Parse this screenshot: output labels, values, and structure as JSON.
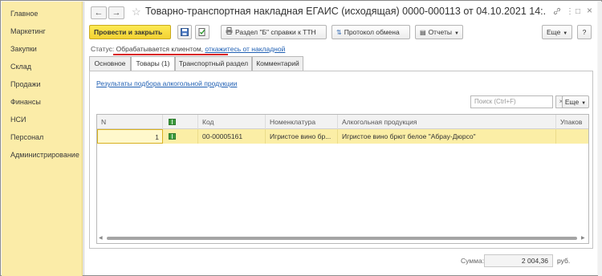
{
  "sidebar": {
    "items": [
      "Главное",
      "Маркетинг",
      "Закупки",
      "Склад",
      "Продажи",
      "Финансы",
      "НСИ",
      "Персонал",
      "Администрирование"
    ]
  },
  "window": {
    "title": "Товарно-транспортная накладная ЕГАИС (исходящая) 0000-000113 от 04.10.2021 14:...",
    "back_icon": "←",
    "forward_icon": "→",
    "star_icon": "☆",
    "link_icon": "🔗",
    "menu_icon": "⋮",
    "max_icon": "□",
    "close_icon": "×"
  },
  "toolbar": {
    "post_close": "Провести и закрыть",
    "section_b": "Раздел \"Б\" справки к ТТН",
    "exchange_protocol": "Протокол обмена",
    "reports": "Отчеты",
    "more": "Еще",
    "help": "?"
  },
  "status": {
    "label": "Статус:",
    "value": "Обрабатывается клиентом,",
    "reject_link": "откажитесь от накладной"
  },
  "tabs": [
    "Основное",
    "Товары (1)",
    "Транспортный раздел",
    "Комментарий"
  ],
  "goods": {
    "results_link": "Результаты подбора алкогольной продукции",
    "search_placeholder": "Поиск (Ctrl+F)",
    "search_clear": "×",
    "more": "Еще",
    "columns": [
      "N",
      "",
      "Код",
      "Номенклатура",
      "Алкогольная продукция",
      "Упаков"
    ],
    "rows": [
      {
        "n": "1",
        "code": "00-00005161",
        "nomenclature": "Игристое вино бр...",
        "product": "Игристое вино брют белое \"Абрау-Дюрсо\""
      }
    ]
  },
  "footer": {
    "sum_label": "Сумма:",
    "sum_value": "2 004,36",
    "currency": "руб."
  },
  "colors": {
    "sidebar_bg": "#fbeca8",
    "primary_button": "#f3d233",
    "selected_row": "#fbeea6",
    "link": "#1f5fb3",
    "status_underline": "#d92424"
  }
}
